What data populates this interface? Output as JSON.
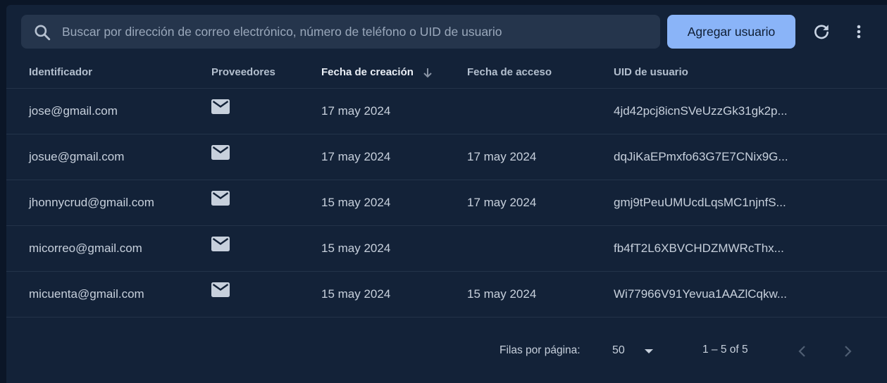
{
  "search": {
    "placeholder": "Buscar por dirección de correo electrónico, número de teléfono o UID de usuario",
    "value": ""
  },
  "toolbar": {
    "add_user_label": "Agregar usuario",
    "refresh_icon": "refresh-icon",
    "more_icon": "more-vert-icon"
  },
  "table": {
    "headers": {
      "identifier": "Identificador",
      "providers": "Proveedores",
      "created": "Fecha de creación",
      "access": "Fecha de acceso",
      "uid": "UID de usuario"
    },
    "sort": {
      "column": "created",
      "direction": "desc"
    },
    "rows": [
      {
        "identifier": "jose@gmail.com",
        "provider_icon": "mail-icon",
        "created": "17 may 2024",
        "access": "",
        "uid": "4jd42pcj8icnSVeUzzGk31gk2p..."
      },
      {
        "identifier": "josue@gmail.com",
        "provider_icon": "mail-icon",
        "created": "17 may 2024",
        "access": "17 may 2024",
        "uid": "dqJiKaEPmxfo63G7E7CNix9G..."
      },
      {
        "identifier": "jhonnycrud@gmail.com",
        "provider_icon": "mail-icon",
        "created": "15 may 2024",
        "access": "17 may 2024",
        "uid": "gmj9tPeuUMUcdLqsMC1njnfS..."
      },
      {
        "identifier": "micorreo@gmail.com",
        "provider_icon": "mail-icon",
        "created": "15 may 2024",
        "access": "",
        "uid": "fb4fT2L6XBVCHDZMWRcThx..."
      },
      {
        "identifier": "micuenta@gmail.com",
        "provider_icon": "mail-icon",
        "created": "15 may 2024",
        "access": "15 may 2024",
        "uid": "Wi77966V91Yevua1AAZlCqkw..."
      }
    ]
  },
  "pagination": {
    "rows_per_page_label": "Filas por página:",
    "rows_per_page": "50",
    "range": "1 – 5 of 5"
  },
  "colors": {
    "background": "#0b1627",
    "panel": "#132238",
    "accent": "#8ab4f8"
  }
}
